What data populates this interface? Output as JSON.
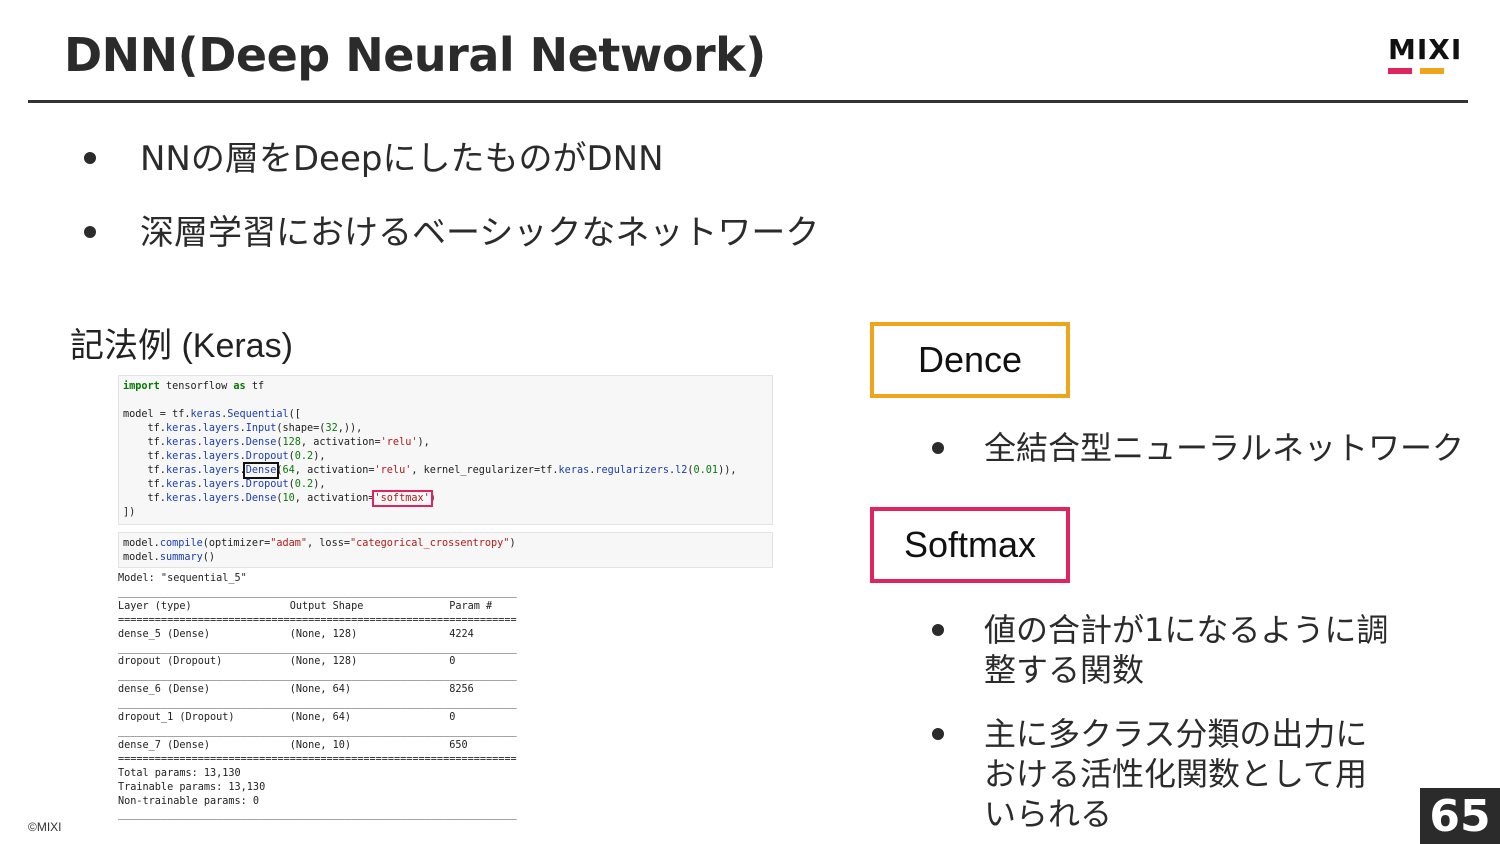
{
  "slide": {
    "title": "DNN(Deep Neural Network)",
    "bullets": [
      "NNの層をDeepにしたものがDNN",
      "深層学習におけるベーシックなネットワーク"
    ],
    "example_label": "記法例 (Keras)",
    "copyright": "©MIXI",
    "page_number": "65"
  },
  "logo": {
    "text": "MIXI",
    "colors": [
      "#e0245e",
      "#f0a41a"
    ]
  },
  "code": {
    "cell1": [
      "import tensorflow as tf",
      "",
      "model = tf.keras.Sequential([",
      "    tf.keras.layers.Input(shape=(32,)),",
      "    tf.keras.layers.Dense(128, activation='relu'),",
      "    tf.keras.layers.Dropout(0.2),",
      "    tf.keras.layers.Dense(64, activation='relu', kernel_regularizer=tf.keras.regularizers.l2(0.01)),",
      "    tf.keras.layers.Dropout(0.2),",
      "    tf.keras.layers.Dense(10, activation='softmax')",
      "])"
    ],
    "cell2": [
      "model.compile(optimizer=\"adam\", loss=\"categorical_crossentropy\")",
      "model.summary()"
    ],
    "summary": [
      "Model: \"sequential_5\"",
      "_________________________________________________________________",
      "Layer (type)                Output Shape              Param #",
      "=================================================================",
      "dense_5 (Dense)             (None, 128)               4224",
      "_________________________________________________________________",
      "dropout (Dropout)           (None, 128)               0",
      "_________________________________________________________________",
      "dense_6 (Dense)             (None, 64)                8256",
      "_________________________________________________________________",
      "dropout_1 (Dropout)         (None, 64)                0",
      "_________________________________________________________________",
      "dense_7 (Dense)             (None, 10)                650",
      "=================================================================",
      "Total params: 13,130",
      "Trainable params: 13,130",
      "Non-trainable params: 0",
      "_________________________________________________________________"
    ]
  },
  "callouts": {
    "dence": {
      "label": "Dence",
      "color": "#f0a41a",
      "bullets": [
        "全結合型ニューラルネットワーク"
      ]
    },
    "softmax": {
      "label": "Softmax",
      "color": "#e0245e",
      "bullets": [
        "値の合計が1になるように調整する関数",
        "主に多クラス分類の出力における活性化関数として用いられる"
      ]
    }
  }
}
